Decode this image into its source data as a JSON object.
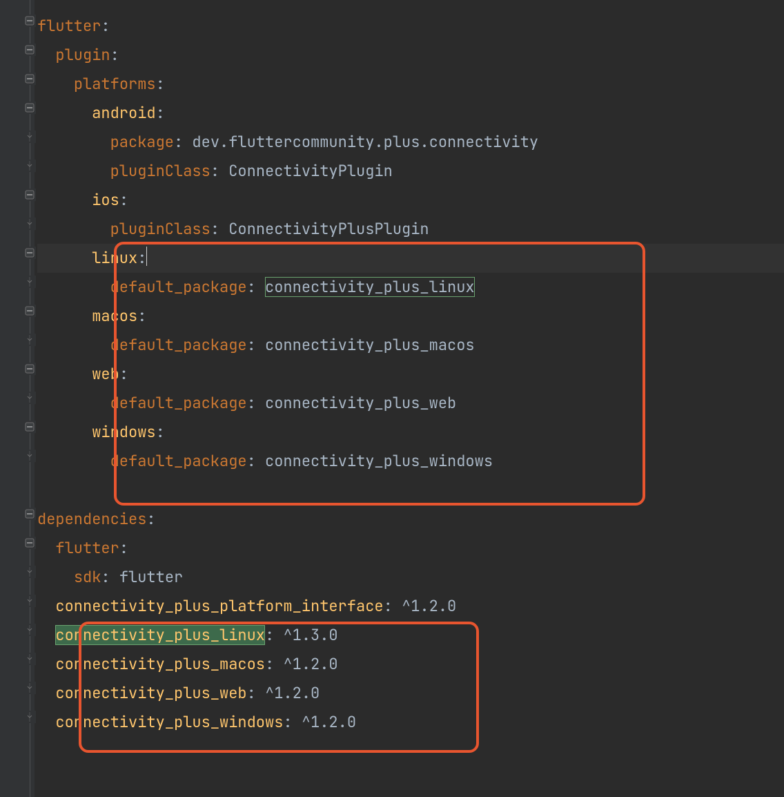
{
  "lines": [
    {
      "indent": 0,
      "key": "flutter",
      "keyClass": "key",
      "value": "",
      "fold": "minus"
    },
    {
      "indent": 1,
      "key": "plugin",
      "keyClass": "key",
      "value": "",
      "fold": "minus"
    },
    {
      "indent": 2,
      "key": "platforms",
      "keyClass": "key",
      "value": "",
      "fold": "minus"
    },
    {
      "indent": 3,
      "key": "android",
      "keyClass": "key2",
      "value": "",
      "fold": "minus"
    },
    {
      "indent": 4,
      "key": "package",
      "keyClass": "key",
      "value": "dev.fluttercommunity.plus.connectivity",
      "fold": "pipe"
    },
    {
      "indent": 4,
      "key": "pluginClass",
      "keyClass": "key",
      "value": "ConnectivityPlugin",
      "fold": "pipe"
    },
    {
      "indent": 3,
      "key": "ios",
      "keyClass": "key2",
      "value": "",
      "fold": "minus"
    },
    {
      "indent": 4,
      "key": "pluginClass",
      "keyClass": "key",
      "value": "ConnectivityPlusPlugin",
      "fold": "pipe"
    },
    {
      "indent": 3,
      "key": "linux",
      "keyClass": "key2",
      "value": "",
      "fold": "minus",
      "caret": true,
      "caretLine": true
    },
    {
      "indent": 4,
      "key": "default_package",
      "keyClass": "key",
      "value": "connectivity_plus_linux",
      "fold": "pipe",
      "valHighlight": "box"
    },
    {
      "indent": 3,
      "key": "macos",
      "keyClass": "key2",
      "value": "",
      "fold": "minus"
    },
    {
      "indent": 4,
      "key": "default_package",
      "keyClass": "key",
      "value": "connectivity_plus_macos",
      "fold": "pipe"
    },
    {
      "indent": 3,
      "key": "web",
      "keyClass": "key2",
      "value": "",
      "fold": "minus"
    },
    {
      "indent": 4,
      "key": "default_package",
      "keyClass": "key",
      "value": "connectivity_plus_web",
      "fold": "pipe"
    },
    {
      "indent": 3,
      "key": "windows",
      "keyClass": "key2",
      "value": "",
      "fold": "minus"
    },
    {
      "indent": 4,
      "key": "default_package",
      "keyClass": "key",
      "value": "connectivity_plus_windows",
      "fold": "pipe"
    },
    {
      "indent": 0,
      "key": "",
      "keyClass": "",
      "value": "",
      "fold": ""
    },
    {
      "indent": 0,
      "key": "dependencies",
      "keyClass": "key",
      "value": "",
      "fold": "minus"
    },
    {
      "indent": 1,
      "key": "flutter",
      "keyClass": "key",
      "value": "",
      "fold": "minus"
    },
    {
      "indent": 2,
      "key": "sdk",
      "keyClass": "key",
      "value": "flutter",
      "fold": "pipe"
    },
    {
      "indent": 1,
      "key": "connectivity_plus_platform_interface",
      "keyClass": "key2",
      "value": "^1.2.0",
      "fold": "pipe"
    },
    {
      "indent": 1,
      "key": "connectivity_plus_linux",
      "keyClass": "key2",
      "value": "^1.3.0",
      "fold": "pipe",
      "keyHighlight": "sel"
    },
    {
      "indent": 1,
      "key": "connectivity_plus_macos",
      "keyClass": "key2",
      "value": "^1.2.0",
      "fold": "pipe"
    },
    {
      "indent": 1,
      "key": "connectivity_plus_web",
      "keyClass": "key2",
      "value": "^1.2.0",
      "fold": "pipe"
    },
    {
      "indent": 1,
      "key": "connectivity_plus_windows",
      "keyClass": "key2",
      "value": "^1.2.0",
      "fold": "pipe"
    }
  ],
  "indentUnit": "  ",
  "colonGap": " "
}
